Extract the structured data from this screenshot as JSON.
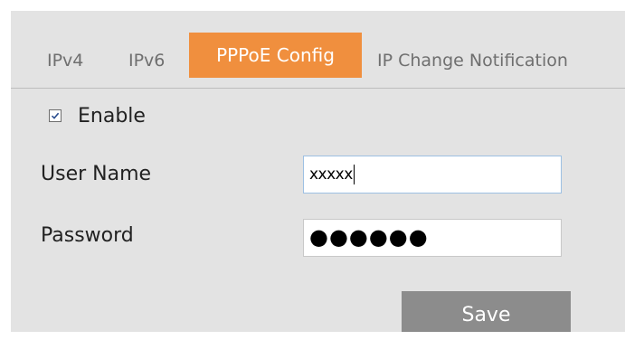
{
  "tabs": [
    {
      "label": "IPv4",
      "active": false
    },
    {
      "label": "IPv6",
      "active": false
    },
    {
      "label": "PPPoE Config",
      "active": true
    },
    {
      "label": "IP Change Notification",
      "active": false
    }
  ],
  "colors": {
    "active_tab_bg": "#f08f3e",
    "panel_bg": "#e3e3e3",
    "save_button_bg": "#8c8c8c"
  },
  "form": {
    "enable": {
      "label": "Enable",
      "checked": true
    },
    "username": {
      "label": "User Name",
      "value": "xxxxx"
    },
    "password": {
      "label": "Password",
      "value": "●●●●●●"
    }
  },
  "actions": {
    "save_label": "Save"
  }
}
